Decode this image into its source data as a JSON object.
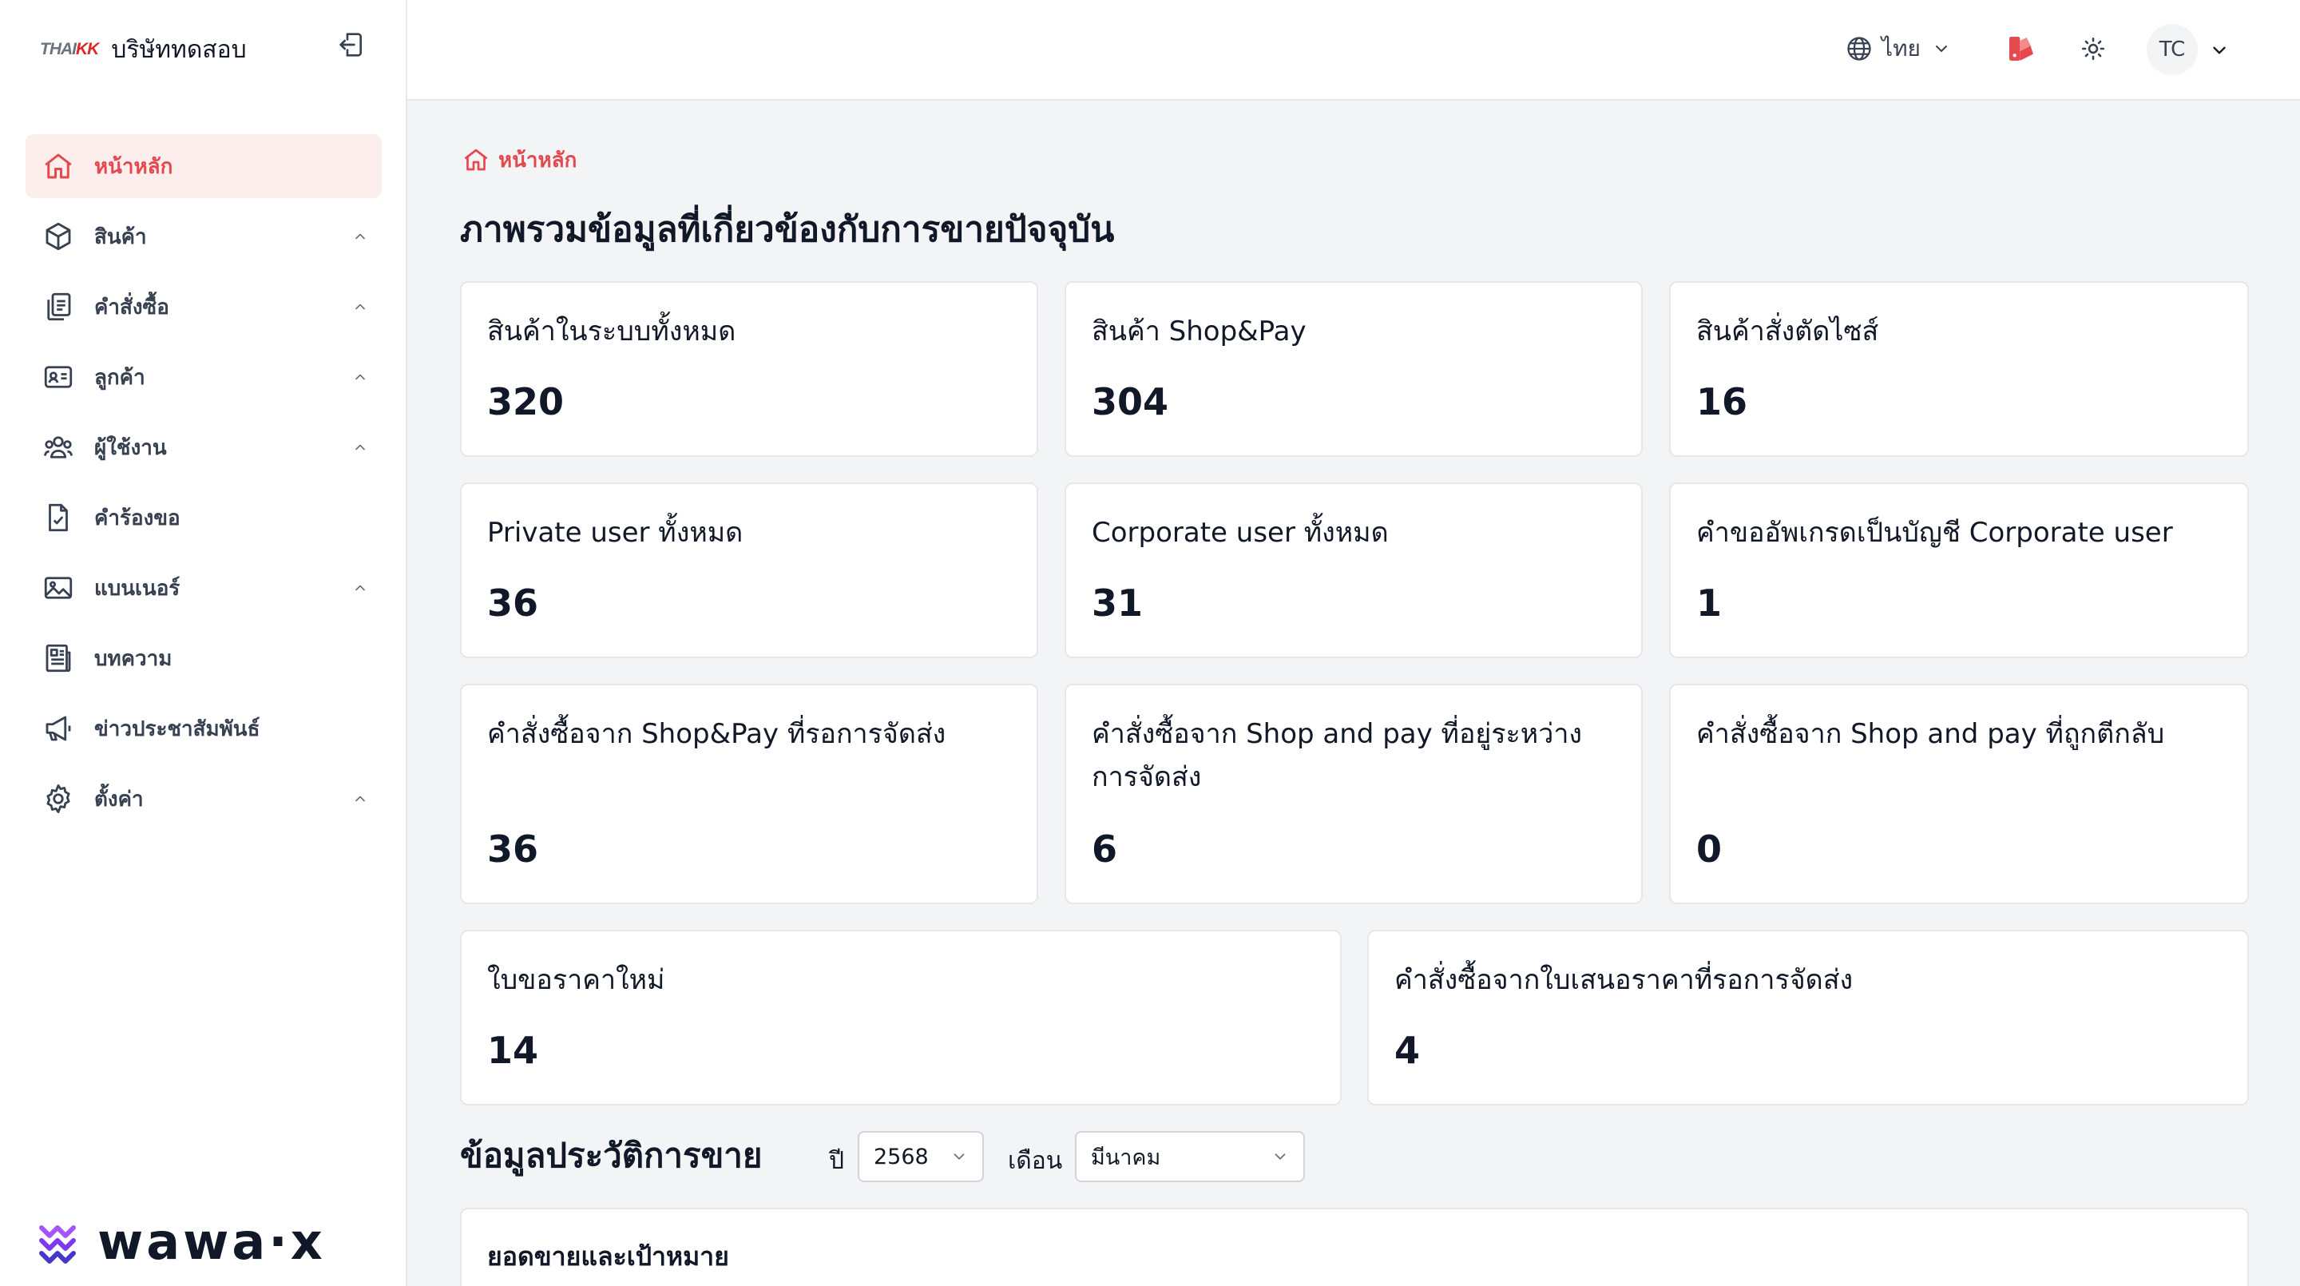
{
  "brand": {
    "logo_text_a": "THAI",
    "logo_text_b": "KK",
    "company_name": "บริษัททดสอบ"
  },
  "sidebar": {
    "items": [
      {
        "label": "หน้าหลัก",
        "icon": "home-icon",
        "active": true,
        "expandable": false
      },
      {
        "label": "สินค้า",
        "icon": "box-icon",
        "active": false,
        "expandable": true
      },
      {
        "label": "คำสั่งซื้อ",
        "icon": "clipboard-icon",
        "active": false,
        "expandable": true
      },
      {
        "label": "ลูกค้า",
        "icon": "id-card-icon",
        "active": false,
        "expandable": true
      },
      {
        "label": "ผู้ใช้งาน",
        "icon": "users-icon",
        "active": false,
        "expandable": true
      },
      {
        "label": "คำร้องขอ",
        "icon": "file-check-icon",
        "active": false,
        "expandable": false
      },
      {
        "label": "แบนเนอร์",
        "icon": "image-icon",
        "active": false,
        "expandable": true
      },
      {
        "label": "บทความ",
        "icon": "newspaper-icon",
        "active": false,
        "expandable": false
      },
      {
        "label": "ข่าวประชาสัมพันธ์",
        "icon": "megaphone-icon",
        "active": false,
        "expandable": false
      },
      {
        "label": "ตั้งค่า",
        "icon": "gear-icon",
        "active": false,
        "expandable": true
      }
    ],
    "footer_logo": "wawa·x"
  },
  "topbar": {
    "language": "ไทย",
    "avatar_initials": "TC"
  },
  "breadcrumb": {
    "label": "หน้าหลัก"
  },
  "page_title": "ภาพรวมข้อมูลที่เกี่ยวข้องกับการขายปัจจุบัน",
  "stats": [
    {
      "label": "สินค้าในระบบทั้งหมด",
      "value": "320"
    },
    {
      "label": "สินค้า Shop&Pay",
      "value": "304"
    },
    {
      "label": "สินค้าสั่งตัดไซส์",
      "value": "16"
    },
    {
      "label": "Private user ทั้งหมด",
      "value": "36"
    },
    {
      "label": "Corporate user ทั้งหมด",
      "value": "31"
    },
    {
      "label": "คำขออัพเกรดเป็นบัญชี Corporate user",
      "value": "1"
    },
    {
      "label": "คำสั่งซื้อจาก Shop&Pay ที่รอการจัดส่ง",
      "value": "36"
    },
    {
      "label": "คำสั่งซื้อจาก Shop and pay ที่อยู่ระหว่างการจัดส่ง",
      "value": "6"
    },
    {
      "label": "คำสั่งซื้อจาก Shop and pay ที่ถูกตีกลับ",
      "value": "0"
    },
    {
      "label": "ใบขอราคาใหม่",
      "value": "14"
    },
    {
      "label": "คำสั่งซื้อจากใบเสนอราคาที่รอการจัดส่ง",
      "value": "4"
    }
  ],
  "history": {
    "title": "ข้อมูลประวัติการขาย",
    "year_label": "ปี",
    "year_value": "2568",
    "month_label": "เดือน",
    "month_value": "มีนาคม"
  },
  "sales_card": {
    "title": "ยอดขายและเป้าหมาย"
  },
  "colors": {
    "accent": "#e5484d",
    "active_bg": "#fdeeee",
    "page_bg": "#f3f4f6"
  }
}
